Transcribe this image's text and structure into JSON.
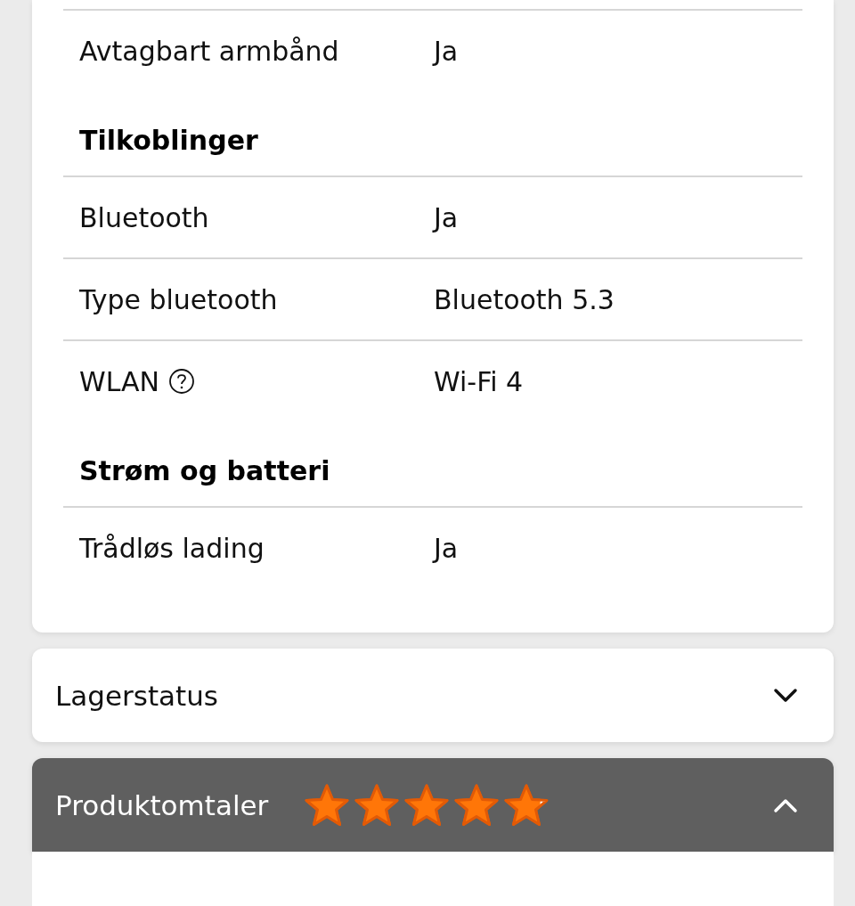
{
  "spec_groups": [
    {
      "rows": [
        {
          "label": "Avtagbart armbånd",
          "help": false,
          "value": "Ja"
        }
      ]
    },
    {
      "heading": "Tilkoblinger",
      "rows": [
        {
          "label": "Bluetooth",
          "help": false,
          "value": "Ja"
        },
        {
          "label": "Type bluetooth",
          "help": false,
          "value": "Bluetooth 5.3"
        },
        {
          "label": "WLAN",
          "help": true,
          "value": "Wi-Fi 4"
        }
      ]
    },
    {
      "heading": "Strøm og batteri",
      "rows": [
        {
          "label": "Trådløs lading",
          "help": false,
          "value": "Ja"
        }
      ]
    }
  ],
  "sections": [
    {
      "title": "Lagerstatus",
      "expanded": false
    },
    {
      "title": "Produktomtaler",
      "expanded": true,
      "stars": 4.8
    }
  ]
}
